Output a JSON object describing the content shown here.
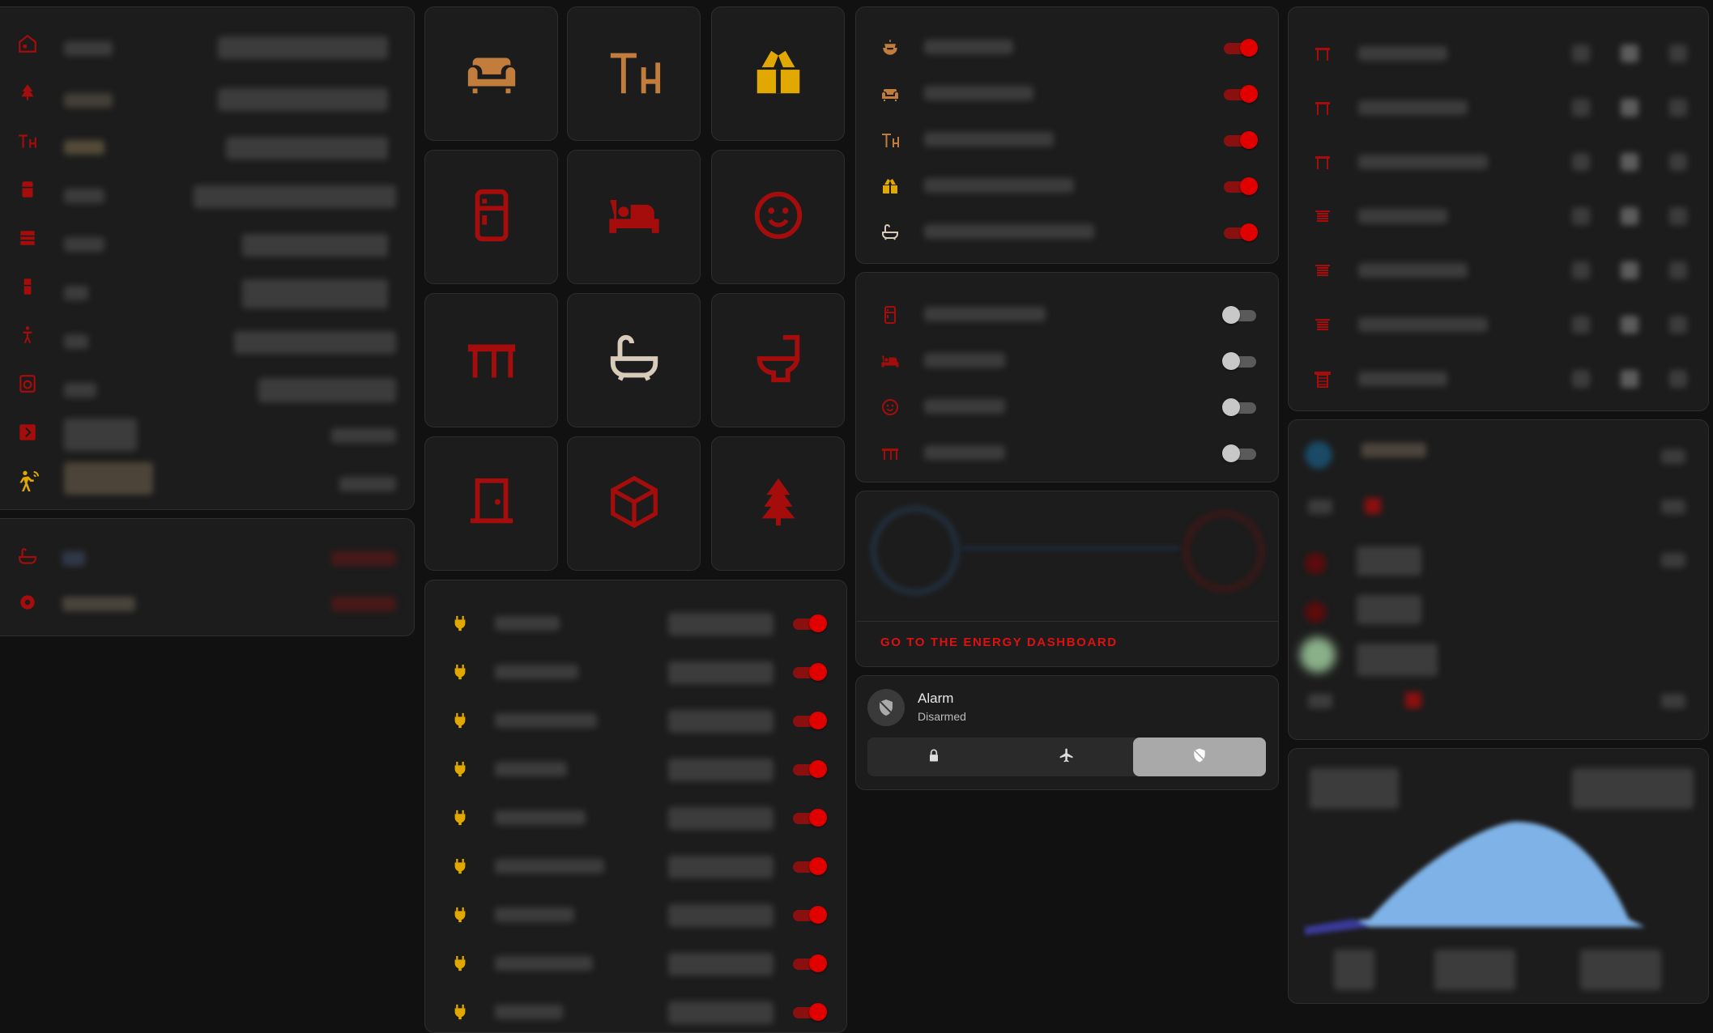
{
  "colors": {
    "accent_red": "#e00000",
    "dark_red": "#a50d0d",
    "icon_orange": "#c27c3c",
    "icon_gold": "#e0a800",
    "icon_light": "#d9cbb9",
    "switch_on": "#e00000",
    "switch_off": "#c8c8c8"
  },
  "left_panel": {
    "icons": [
      "home-floorplan-icon",
      "pine-tree-icon",
      "table-chair-icon",
      "fridge-icon",
      "dresser-icon",
      "fridge-small-icon",
      "person-icon",
      "washer-icon",
      "arrow-box-icon",
      "motion-sensor-icon"
    ]
  },
  "left_small_panel": {
    "icons": [
      "bathtub-icon",
      "gear-icon"
    ]
  },
  "tiles": [
    {
      "icon": "sofa-icon",
      "color": "orange"
    },
    {
      "icon": "table-chair-icon",
      "color": "orange"
    },
    {
      "icon": "gift-open-icon",
      "color": "gold"
    },
    {
      "icon": "fridge-icon",
      "color": "red"
    },
    {
      "icon": "bed-icon",
      "color": "red"
    },
    {
      "icon": "baby-face-icon",
      "color": "red"
    },
    {
      "icon": "desk-icon",
      "color": "red"
    },
    {
      "icon": "bathtub-icon",
      "color": "light"
    },
    {
      "icon": "toilet-icon",
      "color": "red"
    },
    {
      "icon": "door-icon",
      "color": "red"
    },
    {
      "icon": "cube-icon",
      "color": "red"
    },
    {
      "icon": "pine-tree-icon",
      "color": "red"
    }
  ],
  "plugs_panel": {
    "row_count_visible": 9,
    "icon": "power-plug-icon",
    "all_on": true
  },
  "lights_panel": {
    "rows": [
      {
        "icon": "chandelier-icon",
        "on": true
      },
      {
        "icon": "sofa-icon",
        "on": true
      },
      {
        "icon": "table-chair-icon",
        "on": true
      },
      {
        "icon": "gift-open-icon",
        "on": true
      },
      {
        "icon": "bathtub-icon",
        "on": true
      }
    ]
  },
  "rooms_panel": {
    "rows": [
      {
        "icon": "fridge-icon",
        "on": false
      },
      {
        "icon": "bed-icon",
        "on": false
      },
      {
        "icon": "baby-face-icon",
        "on": false
      },
      {
        "icon": "desk-icon",
        "on": false
      }
    ]
  },
  "energy_panel": {
    "link_label": "GO TO THE ENERGY DASHBOARD"
  },
  "alarm_panel": {
    "title": "Alarm",
    "state": "Disarmed",
    "modes": [
      {
        "icon": "lock-icon",
        "active": false
      },
      {
        "icon": "airplane-icon",
        "active": false
      },
      {
        "icon": "shield-off-icon",
        "active": true
      }
    ]
  },
  "covers_panel": {
    "icons": [
      "window-shutter-icon",
      "window-shutter-icon",
      "window-shutter-icon",
      "blinds-icon",
      "blinds-icon",
      "blinds-icon",
      "blinds-open-icon"
    ]
  }
}
